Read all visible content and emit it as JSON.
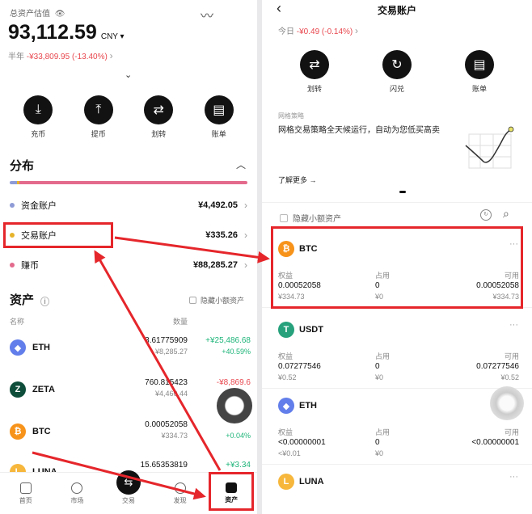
{
  "left": {
    "top": {
      "total_label": "总资产估值",
      "total_value": "93,112.59",
      "currency": "CNY",
      "range_label": "半年",
      "range_change": "-¥33,809.95 (-13.40%)"
    },
    "actions": [
      {
        "label": "充币",
        "icon": "deposit-icon"
      },
      {
        "label": "提币",
        "icon": "withdraw-icon"
      },
      {
        "label": "划转",
        "icon": "transfer-icon"
      },
      {
        "label": "账单",
        "icon": "bill-icon"
      }
    ],
    "distribution": {
      "title": "分布",
      "accounts": [
        {
          "name": "资金账户",
          "value": "¥4,492.05",
          "color": "#8e9bd6"
        },
        {
          "name": "交易账户",
          "value": "¥335.26",
          "color": "#e6b32a"
        },
        {
          "name": "赚币",
          "value": "¥88,285.27",
          "color": "#e36a8c"
        }
      ]
    },
    "assets": {
      "title": "资产",
      "hide_small": "隐藏小额资产",
      "col_name": "名称",
      "col_qty": "数量",
      "rows": [
        {
          "name": "ETH",
          "qty": "3.61775909",
          "qty_cny": "¥8,285.27",
          "change": "+¥25,486.68",
          "pct": "+40.59%",
          "positive": true,
          "color": "#627eea",
          "glyph": "◆"
        },
        {
          "name": "ZETA",
          "qty": "760.815423",
          "qty_cny": "¥4,460.44",
          "change": "-¥8,869.6",
          "pct": "",
          "positive": false,
          "color": "#0d4d3a",
          "glyph": "Z"
        },
        {
          "name": "BTC",
          "qty": "0.00052058",
          "qty_cny": "¥334.73",
          "change": "",
          "pct": "+0.04%",
          "positive": true,
          "color": "#f7931a",
          "glyph": "₿"
        },
        {
          "name": "LUNA",
          "qty": "15.65353819",
          "qty_cny": "",
          "change": "+¥3.34",
          "pct": "",
          "positive": true,
          "color": "#f6b73c",
          "glyph": "L"
        }
      ]
    },
    "tabs": [
      {
        "label": "首页"
      },
      {
        "label": "市场"
      },
      {
        "label": "交易"
      },
      {
        "label": "发现"
      },
      {
        "label": "资产"
      }
    ]
  },
  "right": {
    "title": "交易账户",
    "today_label": "今日",
    "today_change": "-¥0.49 (-0.14%)",
    "actions": [
      {
        "label": "划转",
        "icon": "transfer-icon"
      },
      {
        "label": "闪兑",
        "icon": "flash-swap-icon"
      },
      {
        "label": "账单",
        "icon": "bill-icon"
      }
    ],
    "strategy": {
      "label": "网格策略",
      "desc": "网格交易策略全天候运行，自动为您低买高卖",
      "more": "了解更多 →"
    },
    "hide_small": "隐藏小额资产",
    "col_equity": "权益",
    "col_used": "占用",
    "col_available": "可用",
    "coins": [
      {
        "name": "BTC",
        "equity": "0.00052058",
        "equity_cny": "¥334.73",
        "used": "0",
        "used_cny": "¥0",
        "available": "0.00052058",
        "available_cny": "¥334.73",
        "color": "#f7931a",
        "glyph": "₿"
      },
      {
        "name": "USDT",
        "equity": "0.07277546",
        "equity_cny": "¥0.52",
        "used": "0",
        "used_cny": "¥0",
        "available": "0.07277546",
        "available_cny": "¥0.52",
        "color": "#26a17b",
        "glyph": "T"
      },
      {
        "name": "ETH",
        "equity": "<0.00000001",
        "equity_cny": "<¥0.01",
        "used": "0",
        "used_cny": "¥0",
        "available": "<0.00000001",
        "available_cny": "",
        "color": "#627eea",
        "glyph": "◆"
      },
      {
        "name": "LUNA",
        "equity": "",
        "equity_cny": "",
        "used": "",
        "used_cny": "",
        "available": "",
        "available_cny": "",
        "color": "#f6b73c",
        "glyph": "L"
      }
    ]
  },
  "colors": {
    "highlight": "#e5262b",
    "positive": "#1fb57a",
    "negative": "#e8474e"
  }
}
